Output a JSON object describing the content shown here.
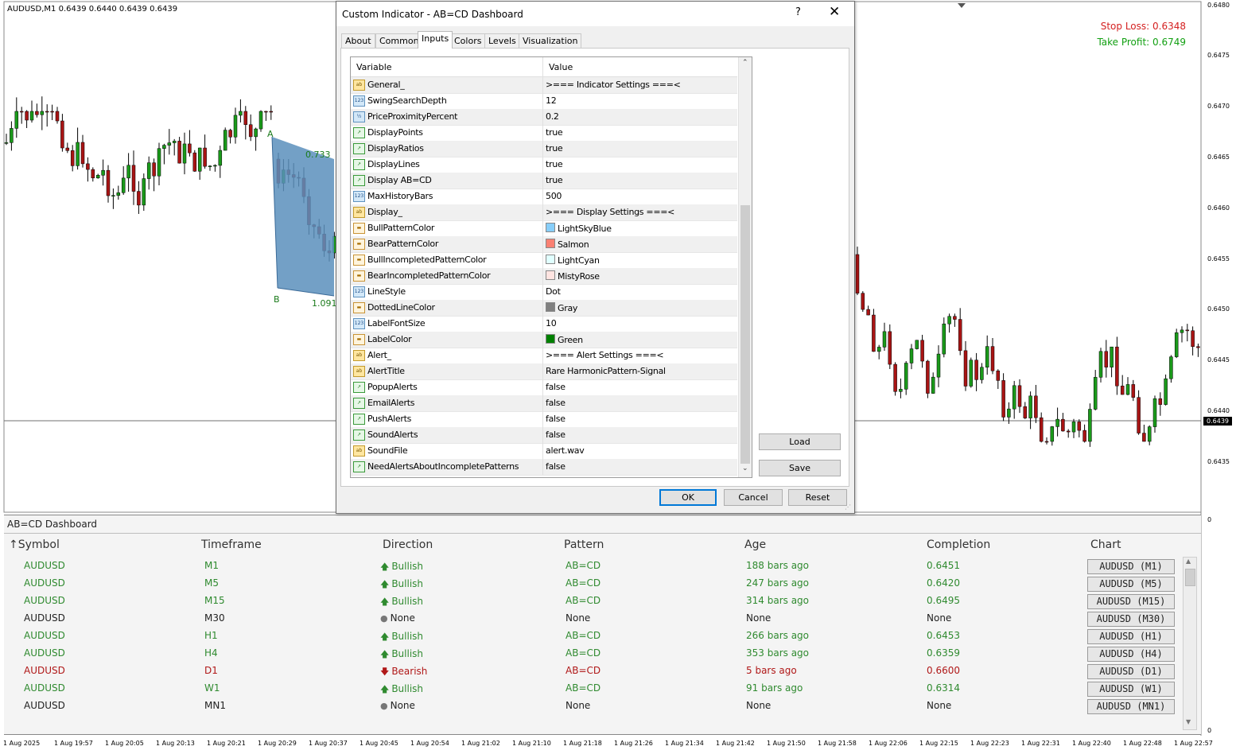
{
  "chart": {
    "symbol_info": "AUDUSD,M1  0.6439 0.6440 0.6439 0.6439",
    "stop_loss": "Stop Loss: 0.6348",
    "take_profit": "Take Profit: 0.6749",
    "current_price": "0.6439",
    "price_scale": [
      "0.6480",
      "0.6475",
      "0.6470",
      "0.6465",
      "0.6460",
      "0.6455",
      "0.6450",
      "0.6445",
      "0.6440",
      "0.6435"
    ],
    "price_scale_bottom": [
      "0",
      "0"
    ],
    "time_scale": [
      "1 Aug 2025",
      "1 Aug 19:57",
      "1 Aug 20:05",
      "1 Aug 20:13",
      "1 Aug 20:21",
      "1 Aug 20:29",
      "1 Aug 20:37",
      "1 Aug 20:45",
      "1 Aug 20:54",
      "1 Aug 21:02",
      "1 Aug 21:10",
      "1 Aug 21:18",
      "1 Aug 21:26",
      "1 Aug 21:34",
      "1 Aug 21:42",
      "1 Aug 21:50",
      "1 Aug 21:58",
      "1 Aug 22:06",
      "1 Aug 22:15",
      "1 Aug 22:23",
      "1 Aug 22:31",
      "1 Aug 22:40",
      "1 Aug 22:48",
      "1 Aug 22:57"
    ],
    "pattern_points": {
      "a": "A",
      "b": "B"
    },
    "pattern_ratios": {
      "first": "0.733",
      "second": "1.091"
    },
    "colors": {
      "bull": "#1a9a1a",
      "bear": "#a81414",
      "pattern_fill": "#5b8fbc"
    }
  },
  "dialog": {
    "title": "Custom Indicator - AB=CD Dashboard",
    "help": "?",
    "close": "✕",
    "tabs": [
      "About",
      "Common",
      "Inputs",
      "Colors",
      "Levels",
      "Visualization"
    ],
    "active_tab": "Inputs",
    "grid_headers": {
      "variable": "Variable",
      "value": "Value"
    },
    "params": [
      {
        "type": "ab",
        "name": "General_",
        "value": ">=== Indicator Settings ===<"
      },
      {
        "type": "num",
        "name": "SwingSearchDepth",
        "value": "12"
      },
      {
        "type": "dbl",
        "name": "PriceProximityPercent",
        "value": "0.2"
      },
      {
        "type": "bool",
        "name": "DisplayPoints",
        "value": "true"
      },
      {
        "type": "bool",
        "name": "DisplayRatios",
        "value": "true"
      },
      {
        "type": "bool",
        "name": "DisplayLines",
        "value": "true"
      },
      {
        "type": "bool",
        "name": "Display AB=CD",
        "value": "true"
      },
      {
        "type": "num",
        "name": "MaxHistoryBars",
        "value": "500"
      },
      {
        "type": "ab",
        "name": "Display_",
        "value": ">=== Display Settings ===<"
      },
      {
        "type": "col",
        "name": "BullPatternColor",
        "value": "LightSkyBlue",
        "swatch": "#87cefa"
      },
      {
        "type": "col",
        "name": "BearPatternColor",
        "value": "Salmon",
        "swatch": "#fa8072"
      },
      {
        "type": "col",
        "name": "BullIncompletedPatternColor",
        "value": "LightCyan",
        "swatch": "#e0ffff"
      },
      {
        "type": "col",
        "name": "BearIncompletedPatternColor",
        "value": "MistyRose",
        "swatch": "#ffe4e1"
      },
      {
        "type": "num",
        "name": "LineStyle",
        "value": "Dot"
      },
      {
        "type": "col",
        "name": "DottedLineColor",
        "value": "Gray",
        "swatch": "#808080"
      },
      {
        "type": "num",
        "name": "LabelFontSize",
        "value": "10"
      },
      {
        "type": "col",
        "name": "LabelColor",
        "value": "Green",
        "swatch": "#008000"
      },
      {
        "type": "ab",
        "name": "Alert_",
        "value": ">=== Alert Settings ===<"
      },
      {
        "type": "ab",
        "name": "AlertTitle",
        "value": "Rare HarmonicPattern-Signal"
      },
      {
        "type": "bool",
        "name": "PopupAlerts",
        "value": "false"
      },
      {
        "type": "bool",
        "name": "EmailAlerts",
        "value": "false"
      },
      {
        "type": "bool",
        "name": "PushAlerts",
        "value": "false"
      },
      {
        "type": "bool",
        "name": "SoundAlerts",
        "value": "false"
      },
      {
        "type": "ab",
        "name": "SoundFile",
        "value": "alert.wav"
      },
      {
        "type": "bool",
        "name": "NeedAlertsAboutIncompletePatterns",
        "value": "false"
      }
    ],
    "icon_text": {
      "ab": "ab",
      "num": "123",
      "dbl": "½",
      "bool": "↗",
      "col": "▬"
    },
    "buttons": {
      "load": "Load",
      "save": "Save",
      "ok": "OK",
      "cancel": "Cancel",
      "reset": "Reset"
    }
  },
  "dashboard": {
    "title": "AB=CD Dashboard",
    "columns": [
      "Symbol",
      "Timeframe",
      "Direction",
      "Pattern",
      "Age",
      "Completion",
      "Chart"
    ],
    "sort_arrow": "↑",
    "rows": [
      {
        "symbol": "AUDUSD",
        "tf": "M1",
        "dir": "Bullish",
        "pattern": "AB=CD",
        "age": "188 bars ago",
        "completion": "0.6451",
        "chart": "AUDUSD (M1)",
        "state": "bull"
      },
      {
        "symbol": "AUDUSD",
        "tf": "M5",
        "dir": "Bullish",
        "pattern": "AB=CD",
        "age": "247 bars ago",
        "completion": "0.6420",
        "chart": "AUDUSD (M5)",
        "state": "bull"
      },
      {
        "symbol": "AUDUSD",
        "tf": "M15",
        "dir": "Bullish",
        "pattern": "AB=CD",
        "age": "314 bars ago",
        "completion": "0.6495",
        "chart": "AUDUSD (M15)",
        "state": "bull"
      },
      {
        "symbol": "AUDUSD",
        "tf": "M30",
        "dir": "None",
        "pattern": "None",
        "age": "None",
        "completion": "None",
        "chart": "AUDUSD (M30)",
        "state": "none"
      },
      {
        "symbol": "AUDUSD",
        "tf": "H1",
        "dir": "Bullish",
        "pattern": "AB=CD",
        "age": "266 bars ago",
        "completion": "0.6453",
        "chart": "AUDUSD (H1)",
        "state": "bull"
      },
      {
        "symbol": "AUDUSD",
        "tf": "H4",
        "dir": "Bullish",
        "pattern": "AB=CD",
        "age": "353 bars ago",
        "completion": "0.6359",
        "chart": "AUDUSD (H4)",
        "state": "bull"
      },
      {
        "symbol": "AUDUSD",
        "tf": "D1",
        "dir": "Bearish",
        "pattern": "AB=CD",
        "age": "5 bars ago",
        "completion": "0.6600",
        "chart": "AUDUSD (D1)",
        "state": "bear"
      },
      {
        "symbol": "AUDUSD",
        "tf": "W1",
        "dir": "Bullish",
        "pattern": "AB=CD",
        "age": "91 bars ago",
        "completion": "0.6314",
        "chart": "AUDUSD (W1)",
        "state": "bull"
      },
      {
        "symbol": "AUDUSD",
        "tf": "MN1",
        "dir": "None",
        "pattern": "None",
        "age": "None",
        "completion": "None",
        "chart": "AUDUSD (MN1)",
        "state": "none"
      }
    ],
    "state_colors": {
      "bull": "#2f8a2f",
      "bear": "#b01818",
      "none": "#222222"
    },
    "dir_icons": {
      "bull": "🡅",
      "bear": "🡇",
      "none": "●"
    }
  }
}
